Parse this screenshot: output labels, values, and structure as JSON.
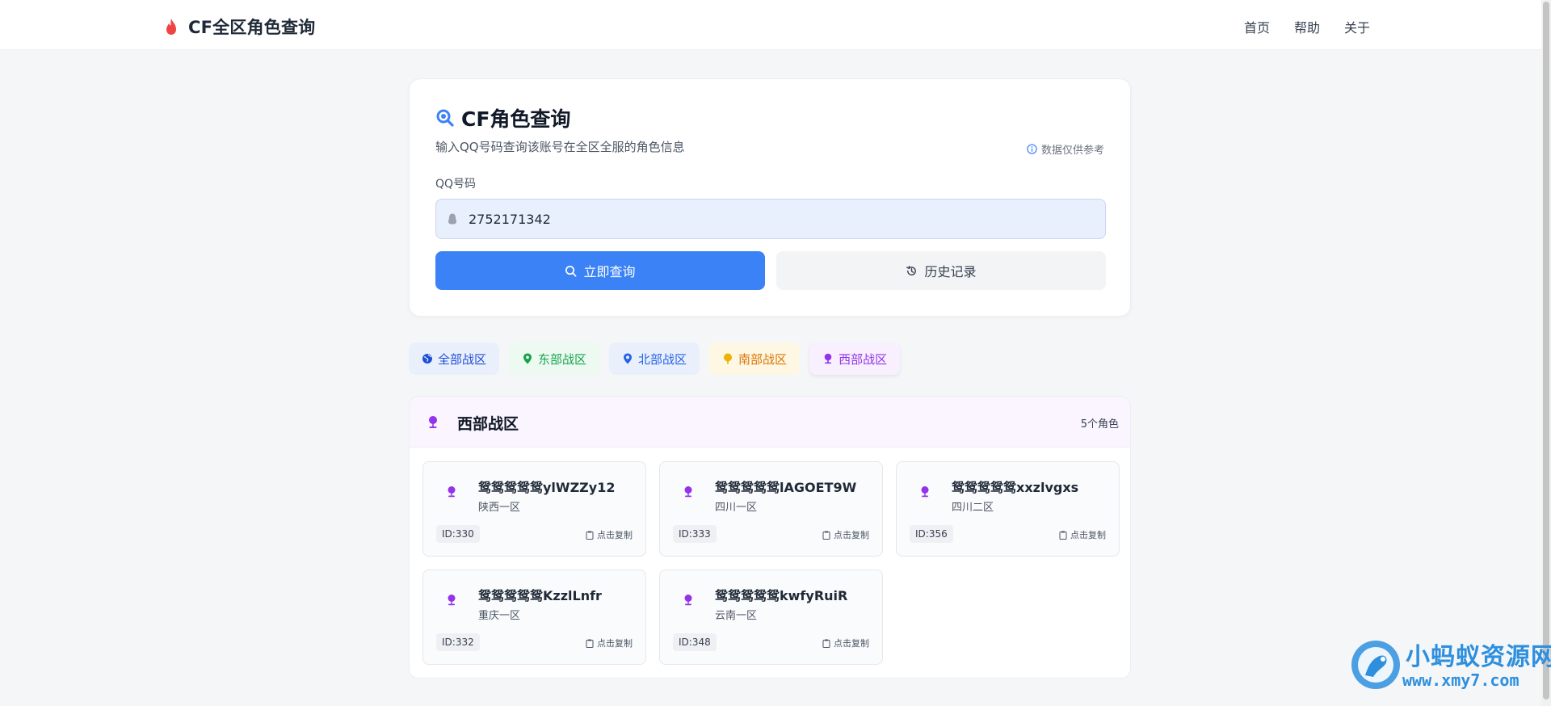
{
  "nav": {
    "brand": "CF全区角色查询",
    "links": [
      "首页",
      "帮助",
      "关于"
    ]
  },
  "search": {
    "title": "CF角色查询",
    "subtitle": "输入QQ号码查询该账号在全区全服的角色信息",
    "disclaimer": "数据仅供参考",
    "field_label": "QQ号码",
    "qq_value": "2752171342",
    "query_button": "立即查询",
    "history_button": "历史记录"
  },
  "tabs": [
    {
      "label": "全部战区",
      "icon": "globe-icon",
      "color": "#1d4ed8"
    },
    {
      "label": "东部战区",
      "icon": "map-pin-icon",
      "color": "#16a34a"
    },
    {
      "label": "北部战区",
      "icon": "map-marker-icon",
      "color": "#2563eb"
    },
    {
      "label": "南部战区",
      "icon": "pin-icon",
      "color": "#d97706"
    },
    {
      "label": "西部战区",
      "icon": "pushpin-icon",
      "color": "#9333ea"
    }
  ],
  "active_tab": "西部战区",
  "results": {
    "title": "西部战区",
    "count": "5个角色",
    "copy_label": "点击复制",
    "roles": [
      {
        "name": "鸳鸳鸳鸳鸳ylWZZy12",
        "server": "陕西一区",
        "id": "ID:330"
      },
      {
        "name": "鸳鸳鸳鸳鸳lAGOET9W",
        "server": "四川一区",
        "id": "ID:333"
      },
      {
        "name": "鸳鸳鸳鸳鸳xxzlvgxs",
        "server": "四川二区",
        "id": "ID:356"
      },
      {
        "name": "鸳鸳鸳鸳鸳KzzlLnfr",
        "server": "重庆一区",
        "id": "ID:332"
      },
      {
        "name": "鸳鸳鸳鸳鸳kwfyRuiR",
        "server": "云南一区",
        "id": "ID:348"
      }
    ]
  },
  "watermark": {
    "line1": "小蚂蚁资源网",
    "line2": "www.xmy7.com"
  },
  "colors": {
    "primary": "#3b82f6",
    "west_accent": "#9333ea",
    "brand_flame": "#ef4444"
  }
}
